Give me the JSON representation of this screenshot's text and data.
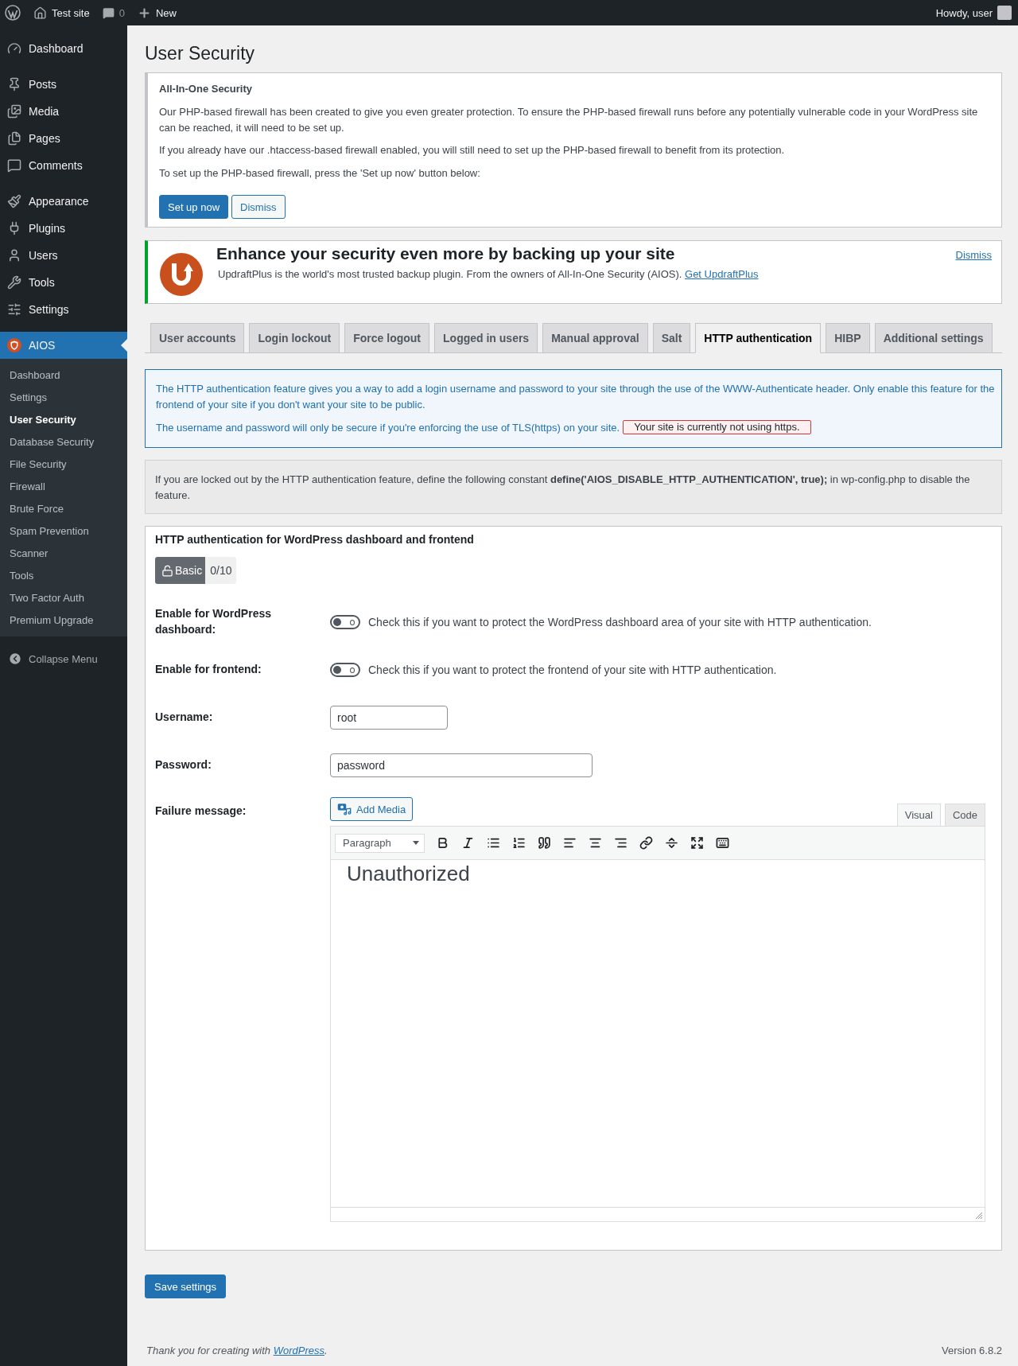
{
  "admin_bar": {
    "site_name": "Test site",
    "comment_count": "0",
    "new_label": "New",
    "greeting": "Howdy, user"
  },
  "sidebar": {
    "groups": [
      [
        {
          "label": "Dashboard",
          "selected": false
        }
      ],
      [
        {
          "label": "Posts",
          "selected": false
        },
        {
          "label": "Media",
          "selected": false
        },
        {
          "label": "Pages",
          "selected": false
        },
        {
          "label": "Comments",
          "selected": false
        }
      ],
      [
        {
          "label": "Appearance",
          "selected": false
        },
        {
          "label": "Plugins",
          "selected": false
        },
        {
          "label": "Users",
          "selected": false
        },
        {
          "label": "Tools",
          "selected": false
        },
        {
          "label": "Settings",
          "selected": false
        }
      ],
      [
        {
          "label": "AIOS",
          "selected": true,
          "expanded": true,
          "children": [
            {
              "label": "Dashboard",
              "selected": false
            },
            {
              "label": "Settings",
              "selected": false
            },
            {
              "label": "User Security",
              "selected": true
            },
            {
              "label": "Database Security",
              "selected": false
            },
            {
              "label": "File Security",
              "selected": false
            },
            {
              "label": "Firewall",
              "selected": false
            },
            {
              "label": "Brute Force",
              "selected": false
            },
            {
              "label": "Spam Prevention",
              "selected": false
            },
            {
              "label": "Scanner",
              "selected": false
            },
            {
              "label": "Tools",
              "selected": false
            },
            {
              "label": "Two Factor Auth",
              "selected": false
            },
            {
              "label": "Premium Upgrade",
              "selected": false
            }
          ]
        }
      ]
    ],
    "collapse_label": "Collapse Menu"
  },
  "page_title": "User Security",
  "firewall_notice": {
    "title": "All-In-One Security",
    "paragraphs": [
      "Our PHP-based firewall has been created to give you even greater protection. To ensure the PHP-based firewall runs before any potentially vulnerable code in your WordPress site can be reached, it will need to be set up.",
      "If you already have our .htaccess-based firewall enabled, you will still need to set up the PHP-based firewall to benefit from its protection.",
      "To set up the PHP-based firewall, press the 'Set up now' button below:"
    ],
    "buttons": [
      {
        "label": "Set up now",
        "kind": "primary"
      },
      {
        "label": "Dismiss",
        "kind": "secondary"
      }
    ]
  },
  "promo": {
    "title": "Enhance your security even more by backing up your site",
    "text": "UpdraftPlus is the world's most trusted backup plugin. From the owners of All-In-One Security (AIOS).",
    "link": "Get UpdraftPlus",
    "dismiss": "Dismiss"
  },
  "tabs": [
    {
      "label": "User accounts",
      "selected": false
    },
    {
      "label": "Login lockout",
      "selected": false
    },
    {
      "label": "Force logout",
      "selected": false
    },
    {
      "label": "Logged in users",
      "selected": false
    },
    {
      "label": "Manual approval",
      "selected": false
    },
    {
      "label": "Salt",
      "selected": false
    },
    {
      "label": "HTTP authentication",
      "selected": true
    },
    {
      "label": "HIBP",
      "selected": false
    },
    {
      "label": "Additional settings",
      "selected": false
    }
  ],
  "info_box": {
    "description": "The HTTP authentication feature gives you a way to add a login username and password to your site through the use of the WWW-Authenticate header. Only enable this feature for the frontend of your site if you don't want your site to be public.",
    "tls_note": "The username and password will only be secure if you're enforcing the use of TLS(https) on your site.",
    "warning": "Your site is currently not using https."
  },
  "lockout_note": "If you are locked out by the HTTP authentication feature, define the following constant **define('AIOS_DISABLE_HTTP_AUTHENTICATION', true);** in wp-config.php to disable the feature.",
  "settings_panel": {
    "title": "HTTP authentication for WordPress dashboard and frontend",
    "badge": {
      "label": "Basic",
      "score": "0/10"
    },
    "fields": [
      {
        "kind": "toggle",
        "label": "Enable for WordPress dashboard:",
        "on": false,
        "description": "Check this if you want to protect the WordPress dashboard area of your site with HTTP authentication."
      },
      {
        "kind": "toggle",
        "label": "Enable for frontend:",
        "on": false,
        "description": "Check this if you want to protect the frontend of your site with HTTP authentication."
      },
      {
        "kind": "short_text",
        "label": "Username:",
        "value": "root"
      },
      {
        "kind": "long_text",
        "label": "Password:",
        "value": "password"
      },
      {
        "kind": "editor",
        "label": "Failure message:",
        "add_media": "Add Media",
        "modes": [
          {
            "label": "Visual",
            "selected": true
          },
          {
            "label": "Code",
            "selected": false
          }
        ],
        "format": "Paragraph",
        "content": "Unauthorized"
      }
    ]
  },
  "save_button": "Save settings",
  "footer": {
    "text_before": "Thank you for creating with ",
    "link": "WordPress",
    "text_after": ".",
    "version": "Version 6.8.2"
  }
}
